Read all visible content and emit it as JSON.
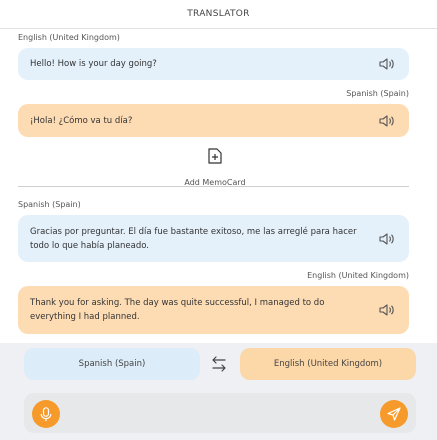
{
  "header": {
    "title": "TRANSLATOR"
  },
  "conversation": [
    {
      "source_lang": "English (United Kingdom)",
      "source_text": "Hello! How is your day going?",
      "target_lang": "Spanish (Spain)",
      "target_text": "¡Hola! ¿Cómo va tu día?"
    },
    {
      "source_lang": "Spanish (Spain)",
      "source_text": "Gracias por preguntar. El día fue bastante exitoso, me las arreglé para hacer todo lo que había planeado.",
      "target_lang": "English (United Kingdom)",
      "target_text": "Thank you for asking. The day was quite successful, I managed to do everything I had planned."
    }
  ],
  "memo": {
    "label": "Add MemoCard"
  },
  "language_selector": {
    "left": "Spanish (Spain)",
    "right": "English (United Kingdom)"
  },
  "input": {
    "value": "",
    "placeholder": ""
  },
  "colors": {
    "blue_bubble": "#e4f1fb",
    "orange_bubble": "#fddcb3",
    "accent": "#f59a2b"
  },
  "icons": {
    "speaker": "speaker-icon",
    "memo": "add-memocard-icon",
    "swap": "swap-arrows-icon",
    "mic": "microphone-icon",
    "send": "send-icon"
  }
}
